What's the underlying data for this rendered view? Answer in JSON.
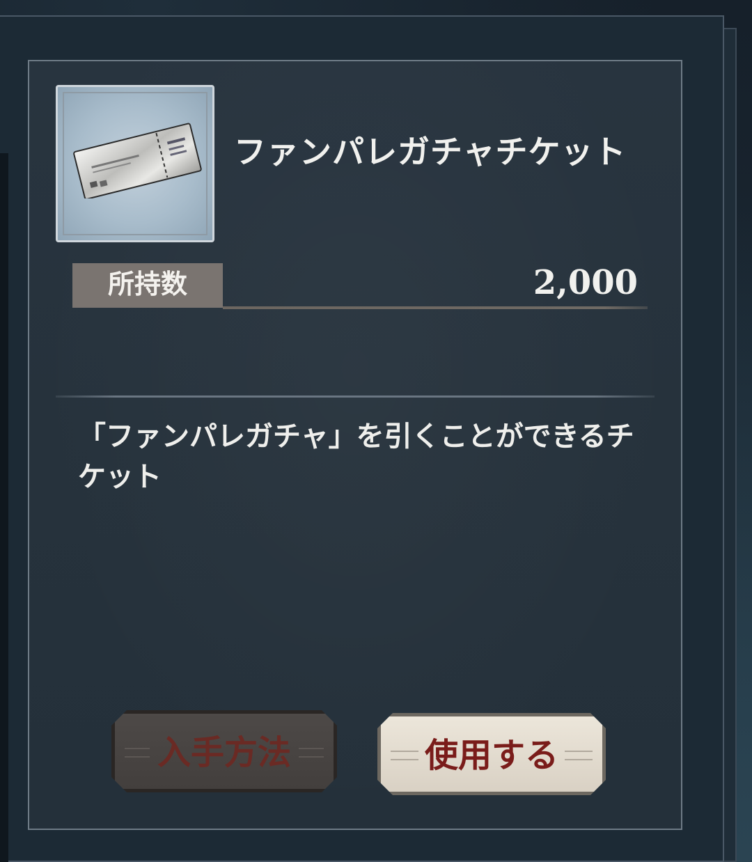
{
  "item": {
    "name": "ファンパレガチャチケット",
    "icon": "silver-ticket-icon"
  },
  "quantity": {
    "label": "所持数",
    "value": "2,000"
  },
  "description": "「ファンパレガチャ」を引くことができるチケット",
  "buttons": {
    "how_to_get": "入手方法",
    "use": "使用する"
  },
  "colors": {
    "panel_bg": "#26323c",
    "text": "#f1f1ee",
    "label_box": "#7a7470",
    "use_button_text": "#7a1c1a",
    "disabled_button_text": "#6a2a24"
  }
}
